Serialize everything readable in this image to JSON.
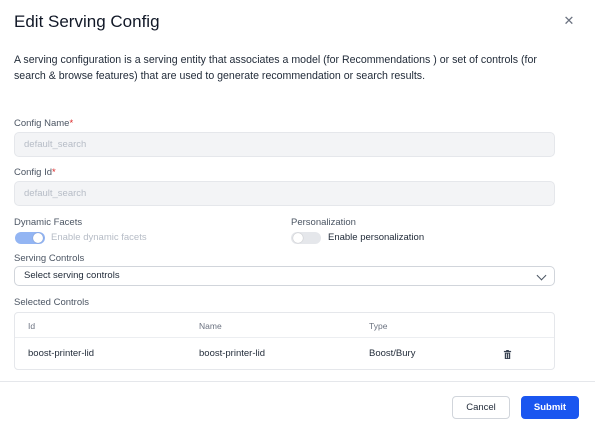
{
  "dialog": {
    "title": "Edit Serving Config",
    "description": "A serving configuration is a serving entity that associates a model (for Recommendations ) or set of controls (for search & browse features) that are used to generate recommendation or search results."
  },
  "form": {
    "config_name": {
      "label": "Config Name",
      "required_mark": "*",
      "placeholder": "default_search"
    },
    "config_id": {
      "label": "Config Id",
      "required_mark": "*",
      "placeholder": "default_search"
    },
    "dynamic_facets": {
      "label": "Dynamic Facets",
      "toggle_text": "Enable dynamic facets",
      "enabled": true
    },
    "personalization": {
      "label": "Personalization",
      "toggle_text": "Enable personalization",
      "enabled": false
    },
    "serving_controls": {
      "label": "Serving Controls",
      "selected": "Select serving controls"
    },
    "selected_controls": {
      "label": "Selected Controls",
      "columns": [
        "Id",
        "Name",
        "Type"
      ],
      "rows": [
        {
          "id": "boost-printer-lid",
          "name": "boost-printer-lid",
          "type": "Boost/Bury"
        }
      ]
    }
  },
  "footer": {
    "cancel_label": "Cancel",
    "submit_label": "Submit"
  },
  "colors": {
    "primary": "#1a56f0",
    "toggle_on": "#93b5f3",
    "required": "#dc2626"
  }
}
